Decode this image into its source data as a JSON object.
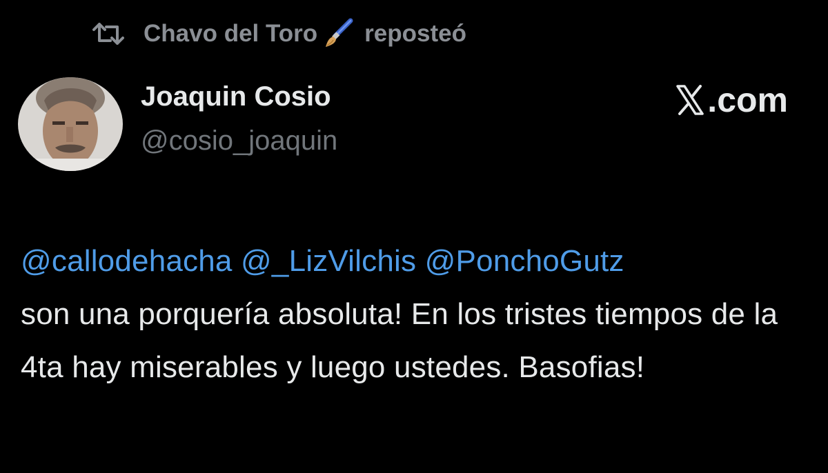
{
  "repost": {
    "icon": "repost-icon",
    "user": "Chavo del Toro",
    "emoji_icon": "paintbrush-icon",
    "label": "reposteó"
  },
  "author": {
    "avatar_icon": "avatar",
    "name": "Joaquin Cosio",
    "handle": "@cosio_joaquin"
  },
  "source": {
    "logo_icon": "x-logo-icon",
    "label": ".com"
  },
  "tweet": {
    "mentions": [
      "@callodehacha",
      "@_LizVilchis",
      "@PonchoGutz"
    ],
    "text": "son una porquería absoluta! En los tristes tiempos de la 4ta hay miserables y luego ustedes. Basofias!"
  },
  "colors": {
    "background": "#000000",
    "mention": "#4f9ce8",
    "muted": "#71767b",
    "text": "#e7e9ea"
  }
}
